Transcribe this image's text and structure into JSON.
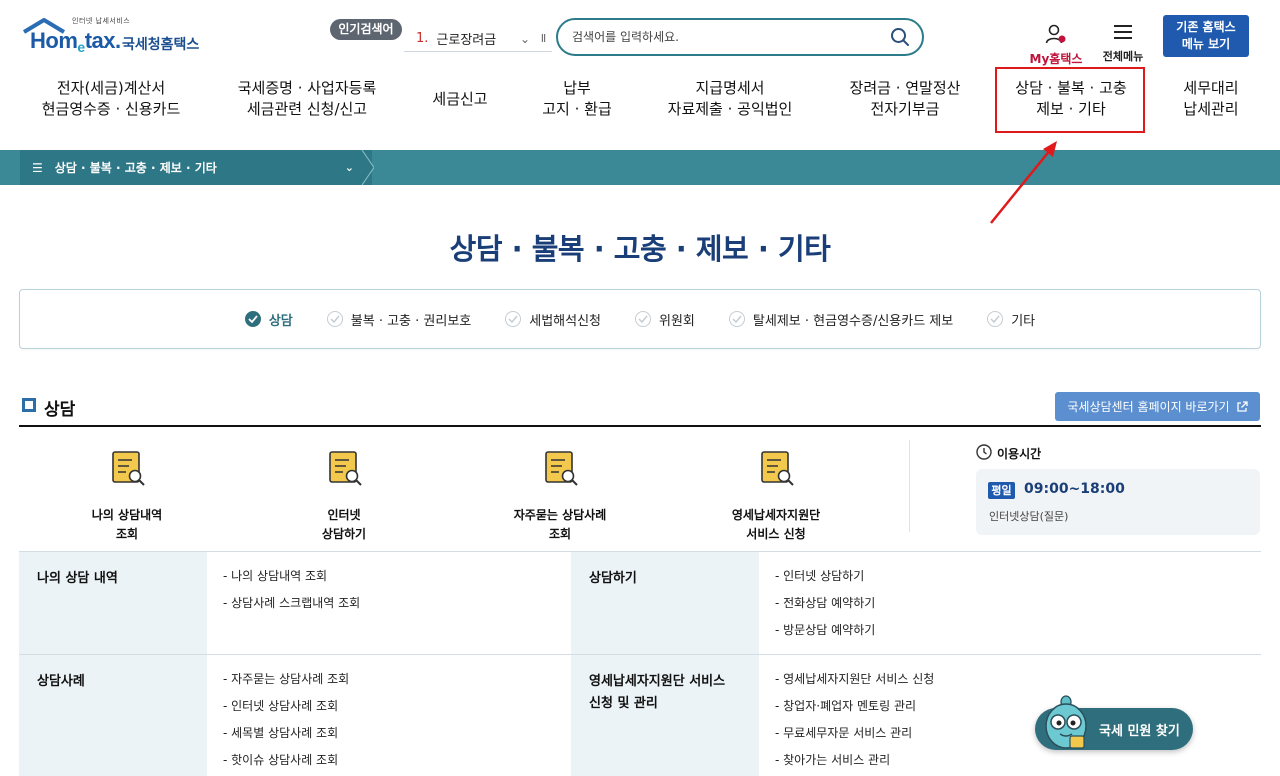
{
  "header": {
    "logo_small": "인터넷 납세서비스",
    "logo_main": "Hom",
    "logo_e": "e",
    "logo_main2": "tax.",
    "logo_kr": "국세청홈택스",
    "popular_tag": "인기검색어",
    "popular_rank": "1.",
    "popular_word": "근로장려금",
    "search_placeholder": "검색어를 입력하세요.",
    "my_hometax": "My홈택스",
    "all_menu": "전체메뉴",
    "old_hometax_line1": "기존 홈택스",
    "old_hometax_line2": "메뉴 보기"
  },
  "gnb": [
    {
      "line1": "전자(세금)계산서",
      "line2": "현금영수증 · 신용카드"
    },
    {
      "line1": "국세증명 · 사업자등록",
      "line2": "세금관련 신청/신고"
    },
    {
      "line1": "세금신고",
      "line2": ""
    },
    {
      "line1": "납부",
      "line2": "고지 · 환급"
    },
    {
      "line1": "지급명세서",
      "line2": "자료제출 · 공익법인"
    },
    {
      "line1": "장려금 · 연말정산",
      "line2": "전자기부금"
    },
    {
      "line1": "상담 · 불복 · 고충",
      "line2": "제보 · 기타"
    },
    {
      "line1": "세무대리",
      "line2": "납세관리"
    }
  ],
  "breadcrumb": "상담 · 불복 · 고충 · 제보 · 기타",
  "page_title": "상담 · 불복 · 고충 · 제보 · 기타",
  "tabs": [
    {
      "label": "상담",
      "active": true
    },
    {
      "label": "불복 · 고충 · 권리보호",
      "active": false
    },
    {
      "label": "세법해석신청",
      "active": false
    },
    {
      "label": "위원회",
      "active": false
    },
    {
      "label": "탈세제보 · 현금영수증/신용카드 제보",
      "active": false
    },
    {
      "label": "기타",
      "active": false
    }
  ],
  "section": {
    "title": "상담",
    "link_button": "국세상담센터 홈페이지 바로가기"
  },
  "quick_links": [
    {
      "line1": "나의 상담내역",
      "line2": "조회"
    },
    {
      "line1": "인터넷",
      "line2": "상담하기"
    },
    {
      "line1": "자주묻는 상담사례",
      "line2": "조회"
    },
    {
      "line1": "영세납세자지원단",
      "line2": "서비스 신청"
    }
  ],
  "hours": {
    "title": "이용시간",
    "badge": "평일",
    "time": "09:00~18:00",
    "sub": "인터넷상담(질문)"
  },
  "table": {
    "row1": {
      "left_head": "나의 상담 내역",
      "left_items": [
        "- 나의 상담내역 조회",
        "- 상담사례 스크랩내역 조회"
      ],
      "right_head": "상담하기",
      "right_items": [
        "- 인터넷 상담하기",
        "- 전화상담 예약하기",
        "- 방문상담 예약하기"
      ]
    },
    "row2": {
      "left_head": "상담사례",
      "left_items": [
        "- 자주묻는 상담사례 조회",
        "- 인터넷 상담사례 조회",
        "- 세목별 상담사례 조회",
        "- 핫이슈 상담사례 조회"
      ],
      "right_head_line1": "영세납세자지원단 서비스",
      "right_head_line2": "신청 및 관리",
      "right_items": [
        "- 영세납세자지원단 서비스 신청",
        "- 창업자·폐업자 멘토링 관리",
        "- 무료세무자문 서비스 관리",
        "- 찾아가는 서비스 관리"
      ]
    }
  },
  "chatbot": "국세 민원 찾기",
  "colors": {
    "teal": "#3b8896",
    "navy": "#1a3e78",
    "blue": "#1f5aae",
    "highlight_red": "#e0191b"
  }
}
